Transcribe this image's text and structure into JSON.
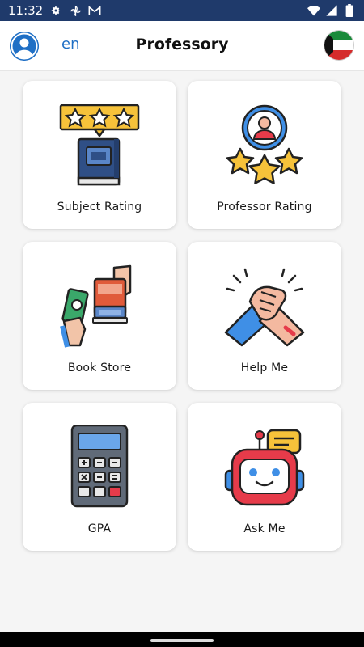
{
  "status_bar": {
    "time": "11:32",
    "left_icons": [
      "gear-icon",
      "pinwheel-icon",
      "gmail-icon"
    ],
    "right_icons": [
      "wifi-icon",
      "signal-icon",
      "battery-icon"
    ]
  },
  "header": {
    "title": "Professory",
    "language": "en",
    "avatar_icon": "user-avatar-icon",
    "flag_icon": "kuwait-flag-icon",
    "accent_color": "#1f6fc5"
  },
  "menu": [
    {
      "label": "Subject Rating",
      "icon": "book-stars-icon"
    },
    {
      "label": "Professor Rating",
      "icon": "professor-stars-icon"
    },
    {
      "label": "Book Store",
      "icon": "book-purchase-icon"
    },
    {
      "label": "Help Me",
      "icon": "handshake-icon"
    },
    {
      "label": "GPA",
      "icon": "calculator-icon"
    },
    {
      "label": "Ask Me",
      "icon": "robot-chat-icon"
    }
  ],
  "colors": {
    "status_bar": "#1f3a6b",
    "background": "#f5f5f5",
    "card": "#ffffff"
  }
}
